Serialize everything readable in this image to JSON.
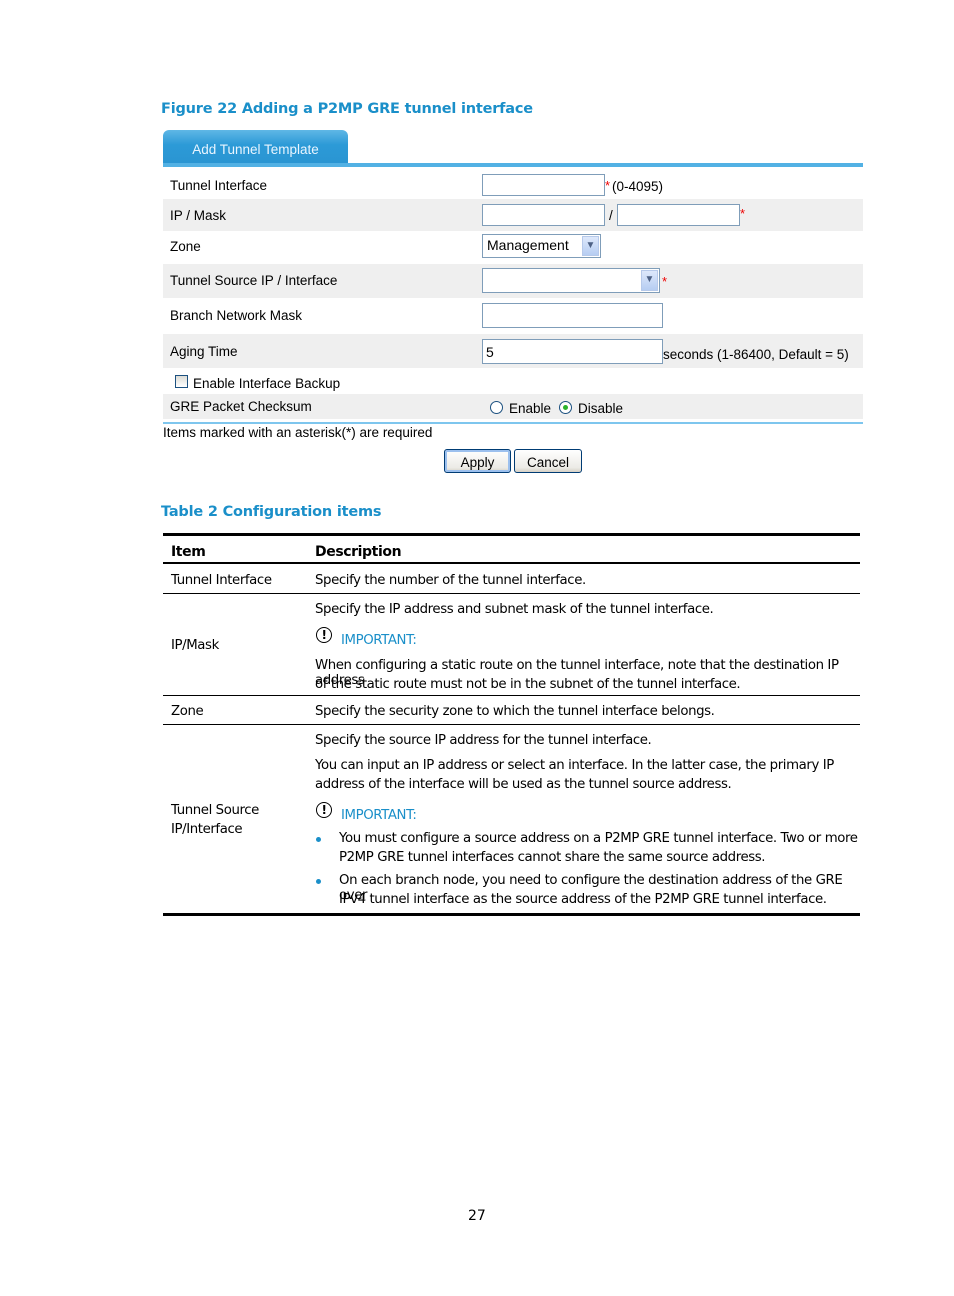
{
  "figure_caption": "Figure 22 Adding a P2MP GRE tunnel interface",
  "form": {
    "tab_label": "Add Tunnel Template",
    "fields": {
      "tunnel_interface": {
        "label": "Tunnel Interface",
        "value": "",
        "hint": "(0-4095)",
        "required": "*"
      },
      "ip_mask": {
        "label": "IP / Mask",
        "ip_value": "",
        "separator": "/",
        "mask_value": "",
        "required": "*"
      },
      "zone": {
        "label": "Zone",
        "selected": "Management",
        "arrow": "⌄"
      },
      "tunnel_source": {
        "label": "Tunnel Source IP / Interface",
        "selected": "",
        "required": "*"
      },
      "branch_network_mask": {
        "label": "Branch Network Mask",
        "value": ""
      },
      "aging_time": {
        "label": "Aging Time",
        "value": "5",
        "hint": "seconds (1-86400, Default = 5)"
      },
      "enable_backup": {
        "label": "Enable Interface Backup",
        "checked": false
      },
      "gre_checksum": {
        "label": "GRE Packet Checksum",
        "options": [
          "Enable",
          "Disable"
        ],
        "selected": "Disable"
      }
    },
    "required_note": "Items marked with an asterisk(*) are required",
    "apply_label": "Apply",
    "cancel_label": "Cancel"
  },
  "table_caption": "Table 2 Configuration items",
  "table": {
    "headers": [
      "Item",
      "Description"
    ],
    "important_label": "IMPORTANT:",
    "important_icon": "!",
    "rows": [
      {
        "item": "Tunnel Interface",
        "desc": [
          "Specify the number of the tunnel interface."
        ]
      },
      {
        "item": "IP/Mask",
        "desc": [
          "Specify the IP address and subnet mask of the tunnel interface."
        ],
        "important": [
          "When configuring a static route on the tunnel interface, note that the destination IP address",
          "of the static route must not be in the subnet of the tunnel interface."
        ]
      },
      {
        "item": "Zone",
        "desc": [
          "Specify the security zone to which the tunnel interface belongs."
        ]
      },
      {
        "item_lines": [
          "Tunnel Source",
          "IP/Interface"
        ],
        "desc": [
          "Specify the source IP address for the tunnel interface.",
          "You can input an IP address or select an interface. In the latter case, the primary IP",
          "address of the interface will be used as the tunnel source address."
        ],
        "bullets": [
          [
            "You must configure a source address on a P2MP GRE tunnel interface. Two or more",
            "P2MP GRE tunnel interfaces cannot share the same source address."
          ],
          [
            "On each branch node, you need to configure the destination address of the GRE over",
            "IPv4 tunnel interface as the source address of the P2MP GRE tunnel interface."
          ]
        ]
      }
    ]
  },
  "page_number": "27"
}
